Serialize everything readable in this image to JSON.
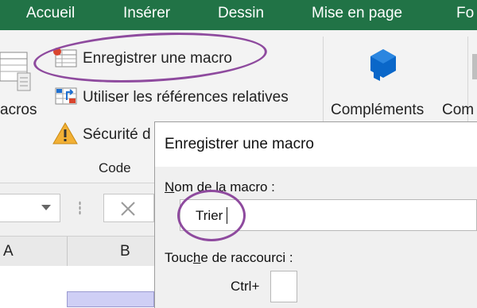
{
  "tabs": [
    "Accueil",
    "Insérer",
    "Dessin",
    "Mise en page",
    "Fo"
  ],
  "ribbon": {
    "macros_label": "acros",
    "record_macro": "Enregistrer une macro",
    "relative_refs": "Utiliser les références relatives",
    "macro_security": "Sécurité d",
    "code_group": "Code",
    "addins_label": "Compléments",
    "addins_label_2": "Com"
  },
  "formula_bar": {
    "name_box_value": "",
    "cancel_icon": "x-icon"
  },
  "columns": [
    "A",
    "B"
  ],
  "dialog": {
    "title": "Enregistrer une macro",
    "name_label_prefix": "N",
    "name_label_rest": "om de la macro :",
    "name_value": "Trier",
    "shortcut_label_prefix": "Touc",
    "shortcut_label_u": "h",
    "shortcut_label_rest": "e de raccourci :",
    "ctrl_label": "Ctrl+",
    "shortcut_value": ""
  },
  "colors": {
    "tab_bar": "#217346",
    "highlight_oval": "#8e4a9e",
    "addins_icon": "#0a67c9"
  }
}
